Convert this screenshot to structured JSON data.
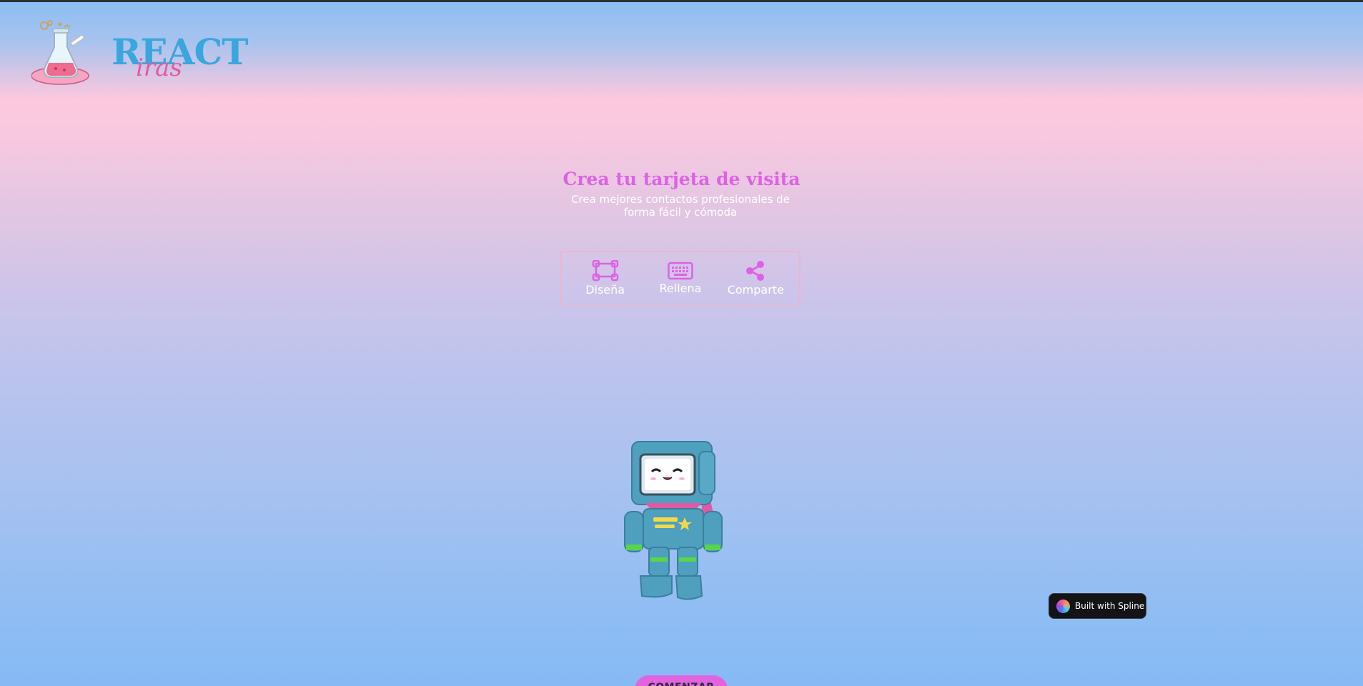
{
  "brand": {
    "name": "REACT",
    "sub": "iras"
  },
  "hero": {
    "title": "Crea tu tarjeta de visita",
    "subtitle": "Crea mejores contactos profesionales de forma fácil y cómoda"
  },
  "steps": [
    {
      "label": "Diseña",
      "icon": "design-frame-icon"
    },
    {
      "label": "Rellena",
      "icon": "keyboard-icon"
    },
    {
      "label": "Comparte",
      "icon": "share-icon"
    }
  ],
  "badge": {
    "label": "Built with Spline"
  },
  "cta": {
    "label": "COMENZAR"
  },
  "colors": {
    "accent": "#dd62e3",
    "button": "#e163e0",
    "logo_blue": "#3aa6de",
    "logo_pink": "#e8589c",
    "badge_bg": "#141416"
  }
}
